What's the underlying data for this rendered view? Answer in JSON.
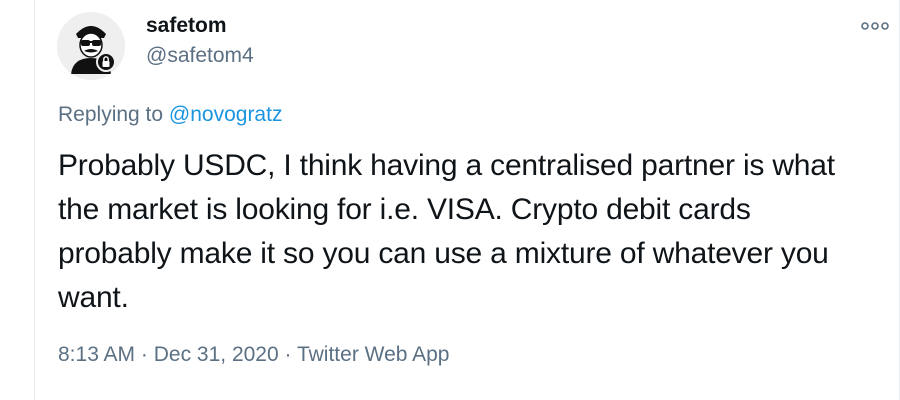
{
  "user": {
    "display_name": "safetom",
    "handle": "@safetom4",
    "avatar_icon": "masked-figure-avatar-icon"
  },
  "more_icon": "more-options-icon",
  "reply": {
    "prefix": "Replying to ",
    "target": "@novogratz"
  },
  "tweet": {
    "text": "Probably USDC, I think having a centralised partner is what the market is looking for i.e. VISA. Crypto debit cards probably make it so you can use a mixture of whatever you want."
  },
  "meta": {
    "time": "8:13 AM",
    "separator": " · ",
    "date": "Dec 31, 2020",
    "source": "Twitter Web App"
  },
  "colors": {
    "link": "#1b95e0",
    "secondary": "#5b7083",
    "primary": "#0f1419",
    "border": "#e6ecf0"
  }
}
